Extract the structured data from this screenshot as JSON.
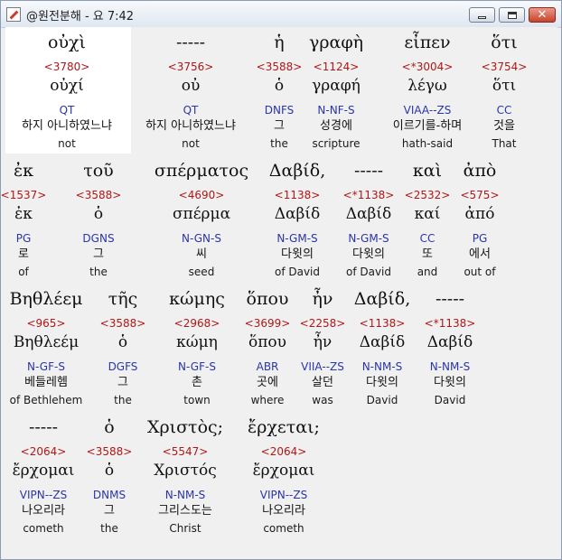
{
  "window": {
    "title": "@원전분해 - 요 7:42"
  },
  "verse": {
    "rows": [
      {
        "words": [
          {
            "greek": "οὐχὶ",
            "code": "<3780>",
            "lemma": "οὐχί",
            "morph": "QT",
            "korean": "하지 아니하였느냐",
            "english": "not"
          },
          {
            "greek": "-----",
            "code": "<3756>",
            "lemma": "οὐ",
            "morph": "QT",
            "korean": "하지 아니하였느냐",
            "english": "not"
          },
          {
            "greek": "ἡ",
            "code": "<3588>",
            "lemma": "ὁ",
            "morph": "DNFS",
            "korean": "그",
            "english": "the"
          },
          {
            "greek": "γραφὴ",
            "code": "<1124>",
            "lemma": "γραφή",
            "morph": "N-NF-S",
            "korean": "성경에",
            "english": "scripture"
          },
          {
            "greek": "εἶπεν",
            "code": "<*3004>",
            "lemma": "λέγω",
            "morph": "VIAA--ZS",
            "korean": "이르기를-하며",
            "english": "hath-said"
          },
          {
            "greek": "ὅτι",
            "code": "<3754>",
            "lemma": "ὅτι",
            "morph": "CC",
            "korean": "것을",
            "english": "That"
          }
        ]
      },
      {
        "words": [
          {
            "greek": "ἐκ",
            "code": "<1537>",
            "lemma": "ἐκ",
            "morph": "PG",
            "korean": "로",
            "english": "of"
          },
          {
            "greek": "τοῦ",
            "code": "<3588>",
            "lemma": "ὁ",
            "morph": "DGNS",
            "korean": "그",
            "english": "the"
          },
          {
            "greek": "σπέρματος",
            "code": "<4690>",
            "lemma": "σπέρμα",
            "morph": "N-GN-S",
            "korean": "씨",
            "english": "seed"
          },
          {
            "greek": "Δαβίδ,",
            "code": "<1138>",
            "lemma": "Δαβίδ",
            "morph": "N-GM-S",
            "korean": "다윗의",
            "english": "of David"
          },
          {
            "greek": "-----",
            "code": "<*1138>",
            "lemma": "Δαβίδ",
            "morph": "N-GM-S",
            "korean": "다윗의",
            "english": "of David"
          },
          {
            "greek": "καὶ",
            "code": "<2532>",
            "lemma": "καί",
            "morph": "CC",
            "korean": "또",
            "english": "and"
          },
          {
            "greek": "ἀπὸ",
            "code": "<575>",
            "lemma": "ἀπό",
            "morph": "PG",
            "korean": "에서",
            "english": "out of"
          }
        ]
      },
      {
        "words": [
          {
            "greek": "Βηθλέεμ",
            "code": "<965>",
            "lemma": "Βηθλεέμ",
            "morph": "N-GF-S",
            "korean": "베들레헴",
            "english": "of Bethlehem"
          },
          {
            "greek": "τῆς",
            "code": "<3588>",
            "lemma": "ὁ",
            "morph": "DGFS",
            "korean": "그",
            "english": "the"
          },
          {
            "greek": "κώμης",
            "code": "<2968>",
            "lemma": "κώμη",
            "morph": "N-GF-S",
            "korean": "촌",
            "english": "town"
          },
          {
            "greek": "ὅπου",
            "code": "<3699>",
            "lemma": "ὅπου",
            "morph": "ABR",
            "korean": "곳에",
            "english": "where"
          },
          {
            "greek": "ἦν",
            "code": "<2258>",
            "lemma": "ἦν",
            "morph": "VIIA--ZS",
            "korean": "살던",
            "english": "was"
          },
          {
            "greek": "Δαβίδ,",
            "code": "<1138>",
            "lemma": "Δαβίδ",
            "morph": "N-NM-S",
            "korean": "다윗의",
            "english": "David"
          },
          {
            "greek": "-----",
            "code": "<*1138>",
            "lemma": "Δαβίδ",
            "morph": "N-NM-S",
            "korean": "다윗의",
            "english": "David"
          }
        ]
      },
      {
        "words": [
          {
            "greek": "-----",
            "code": "<2064>",
            "lemma": "ἔρχομαι",
            "morph": "VIPN--ZS",
            "korean": "나오리라",
            "english": "cometh"
          },
          {
            "greek": "ὁ",
            "code": "<3588>",
            "lemma": "ὁ",
            "morph": "DNMS",
            "korean": "그",
            "english": "the"
          },
          {
            "greek": "Χριστὸς;",
            "code": "<5547>",
            "lemma": "Χριστός",
            "morph": "N-NM-S",
            "korean": "그리스도는",
            "english": "Christ"
          },
          {
            "greek": "ἔρχεται;",
            "code": "<2064>",
            "lemma": "ἔρχομαι",
            "morph": "VIPN--ZS",
            "korean": "나오리라",
            "english": "cometh"
          }
        ]
      }
    ]
  }
}
